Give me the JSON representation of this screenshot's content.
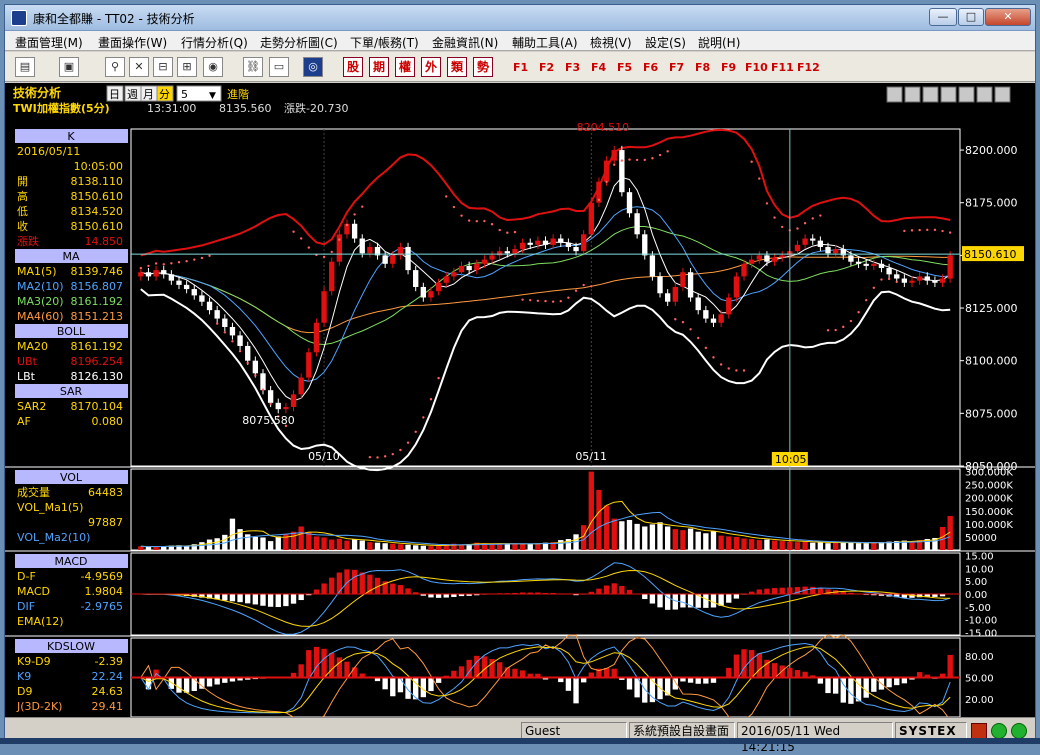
{
  "window": {
    "title": "康和全都賺 - TT02 - 技術分析",
    "buttons": {
      "minimize": "—",
      "maximize": "□",
      "close": "✕"
    }
  },
  "menu": [
    "畫面管理(M)",
    "畫面操作(W)",
    "行情分析(Q)",
    "走勢分析圖(C)",
    "下單/帳務(T)",
    "金融資訊(N)",
    "輔助工具(A)",
    "檢視(V)",
    "設定(S)",
    "說明(H)"
  ],
  "toolbar": {
    "quick_buttons": [
      "股",
      "期",
      "權",
      "外",
      "類",
      "勢"
    ],
    "function_keys": [
      "F1",
      "F2",
      "F3",
      "F4",
      "F5",
      "F6",
      "F7",
      "F8",
      "F9",
      "F10",
      "F11",
      "F12"
    ]
  },
  "header": {
    "panel_title": "技術分析",
    "period_tabs": [
      "日",
      "週",
      "月",
      "分"
    ],
    "minute_value": "5",
    "advanced": "進階",
    "symbol": "TWI",
    "symbol_name": "加權指數(5分)",
    "time": "13:31:00",
    "price": "8135.560",
    "change_label": "漲跌-20.730"
  },
  "colors": {
    "up": "#e01010",
    "down": "#ffffff",
    "bg": "#000000",
    "panel_header": "#b8b8ff",
    "label_yellow": "#ffd700",
    "ub_red": "#e01010",
    "lb_white": "#ffffff"
  },
  "info_panel": {
    "k_header": "K",
    "date": "2016/05/11",
    "time": "10:05:00",
    "ohlc": [
      {
        "label": "開",
        "value": "8138.110"
      },
      {
        "label": "高",
        "value": "8150.610"
      },
      {
        "label": "低",
        "value": "8134.520"
      },
      {
        "label": "收",
        "value": "8150.610"
      },
      {
        "label": "漲跌",
        "value": "14.850"
      }
    ],
    "ma_header": "MA",
    "ma": [
      {
        "label": "MA1(5)",
        "value": "8139.746",
        "color": "#ffd700"
      },
      {
        "label": "MA2(10)",
        "value": "8156.807",
        "color": "#4fa3ff"
      },
      {
        "label": "MA3(20)",
        "value": "8161.192",
        "color": "#7fdf5f"
      },
      {
        "label": "MA4(60)",
        "value": "8151.213",
        "color": "#ff9a40"
      }
    ],
    "boll_header": "BOLL",
    "boll": [
      {
        "label": "MA20",
        "value": "8161.192",
        "color": "#ffd700"
      },
      {
        "label": "UBt",
        "value": "8196.254",
        "color": "#e01010"
      },
      {
        "label": "LBt",
        "value": "8126.130",
        "color": "#ffffff"
      }
    ],
    "sar_header": "SAR",
    "sar": [
      {
        "label": "SAR2",
        "value": "8170.104",
        "color": "#ffd700"
      },
      {
        "label": "AF",
        "value": "0.080",
        "color": "#ffd700"
      }
    ],
    "vol_header": "VOL",
    "vol": [
      {
        "label": "成交量",
        "value": "64483",
        "color": "#ffd700"
      },
      {
        "label": "VOL_Ma1(5)",
        "value": "",
        "color": "#ffd700"
      },
      {
        "label": "",
        "value": "97887",
        "color": "#ffd700"
      },
      {
        "label": "VOL_Ma2(10)",
        "value": "",
        "color": "#4fa3ff"
      }
    ],
    "macd_header": "MACD",
    "macd": [
      {
        "label": "D-F",
        "value": "-4.9569",
        "color": "#ffd700"
      },
      {
        "label": "MACD",
        "value": "1.9804",
        "color": "#ffd700"
      },
      {
        "label": "DIF",
        "value": "-2.9765",
        "color": "#4fa3ff"
      },
      {
        "label": "EMA(12)",
        "value": "",
        "color": "#ffd700"
      }
    ],
    "kd_header": "KDSLOW",
    "kd": [
      {
        "label": "K9-D9",
        "value": "-2.39",
        "color": "#ffd700"
      },
      {
        "label": "K9",
        "value": "22.24",
        "color": "#4fa3ff"
      },
      {
        "label": "D9",
        "value": "24.63",
        "color": "#ffd700"
      },
      {
        "label": "J(3D-2K)",
        "value": "29.41",
        "color": "#ff9a40"
      }
    ]
  },
  "chart_data": {
    "type": "candlestick",
    "price_axis": {
      "ticks": [
        "8200.000",
        "8175.000",
        "8150.000",
        "8125.000",
        "8100.000",
        "8075.000",
        "8050.000"
      ],
      "ylim": [
        8050,
        8210
      ]
    },
    "current_price_label": "8150.610",
    "high_label": "8204.510",
    "low_label": "8075.580",
    "date_labels": [
      "05/10",
      "05/11"
    ],
    "crosshair_time": "10:05",
    "volume_axis": [
      "300.000K",
      "250.000K",
      "200.000K",
      "150.000K",
      "100.000K",
      "50000"
    ],
    "macd_axis": [
      "15.00",
      "10.00",
      "5.00",
      "0.00",
      "-5.00",
      "-10.00",
      "-15.00"
    ],
    "kd_axis": [
      "80.00",
      "50.00",
      "20.00"
    ],
    "closes": [
      8142,
      8140,
      8143,
      8141,
      8138,
      8136,
      8134,
      8131,
      8128,
      8124,
      8120,
      8116,
      8112,
      8107,
      8100,
      8094,
      8086,
      8080,
      8077,
      8078,
      8084,
      8092,
      8104,
      8118,
      8133,
      8147,
      8160,
      8165,
      8158,
      8151,
      8154,
      8150,
      8146,
      8150,
      8154,
      8143,
      8135,
      8130,
      8133,
      8137,
      8140,
      8142,
      8145,
      8143,
      8146,
      8148,
      8150,
      8152,
      8151,
      8153,
      8156,
      8155,
      8157,
      8155,
      8158,
      8156,
      8154,
      8152,
      8160,
      8175,
      8185,
      8195,
      8200,
      8180,
      8170,
      8160,
      8150,
      8140,
      8132,
      8128,
      8135,
      8142,
      8130,
      8124,
      8120,
      8118,
      8122,
      8130,
      8140,
      8146,
      8148,
      8150,
      8147,
      8149,
      8150,
      8152,
      8155,
      8158,
      8157,
      8154,
      8151,
      8153,
      8150,
      8147,
      8146,
      8145,
      8146,
      8144,
      8141,
      8139,
      8137,
      8138,
      8140,
      8138,
      8137,
      8139,
      8150
    ],
    "volumes": [
      14000,
      12000,
      14000,
      13000,
      17000,
      18000,
      16000,
      22000,
      30000,
      40000,
      45000,
      58000,
      120000,
      80000,
      60000,
      50000,
      48000,
      34000,
      52000,
      62000,
      70000,
      90000,
      68000,
      52000,
      48000,
      40000,
      43000,
      36000,
      40000,
      36000,
      30000,
      28000,
      26000,
      24000,
      22000,
      20000,
      18000,
      16000,
      15000,
      17000,
      22000,
      24000,
      20000,
      23000,
      28000,
      26000,
      24000,
      22000,
      23000,
      25000,
      22000,
      24000,
      26000,
      28000,
      30000,
      38000,
      42000,
      60000,
      95000,
      300000,
      230000,
      170000,
      120000,
      110000,
      115000,
      100000,
      90000,
      98000,
      106000,
      90000,
      80000,
      76000,
      82000,
      70000,
      64000,
      72000,
      55000,
      52000,
      50000,
      44000,
      42000,
      38000,
      40000,
      36000,
      34000,
      32000,
      30000,
      32000,
      28000,
      30000,
      26000,
      28000,
      30000,
      28000,
      26000,
      26000,
      28000,
      30000,
      32000,
      34000,
      36000,
      32000,
      38000,
      42000,
      46000,
      88000,
      130000
    ]
  },
  "status": {
    "user": "Guest",
    "layout": "系統預設自設畫面",
    "datetime": "2016/05/11 Wed 14:21:15",
    "brand": "SYSTEX"
  }
}
